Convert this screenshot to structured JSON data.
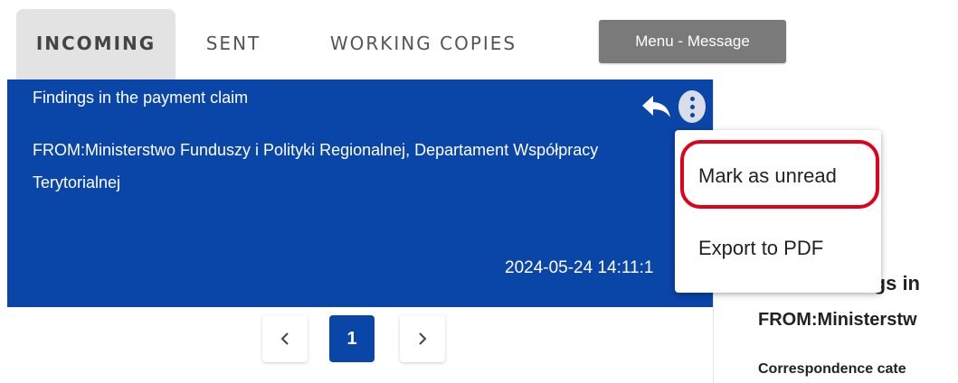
{
  "tabs": {
    "incoming": "INCOMING",
    "sent": "SENT",
    "working_copies": "WORKING COPIES"
  },
  "menu_message_label": "Menu - Message",
  "message": {
    "title": "Findings in the payment claim",
    "from": "FROM:Ministerstwo Funduszy i Polityki Regionalnej, Departament Współpracy Terytorialnej",
    "date": "2024-05-24 14:11:1"
  },
  "popup_menu": {
    "mark_as_unread": "Mark as unread",
    "export_to_pdf": "Export to PDF"
  },
  "detail_panel": {
    "subject_fragment": "lings in",
    "from_fragment": "FROM:Ministerstw",
    "category_fragment": "Correspondence cate"
  },
  "pagination": {
    "current_page": "1"
  },
  "colors": {
    "primary": "#0a45a8",
    "highlight": "#e0001b",
    "menu_button": "#7a7a7a",
    "active_tab": "#e3e3e3"
  },
  "icons": {
    "reply": "reply-icon",
    "more": "more-vertical-icon",
    "prev": "chevron-left-icon",
    "next": "chevron-right-icon"
  }
}
